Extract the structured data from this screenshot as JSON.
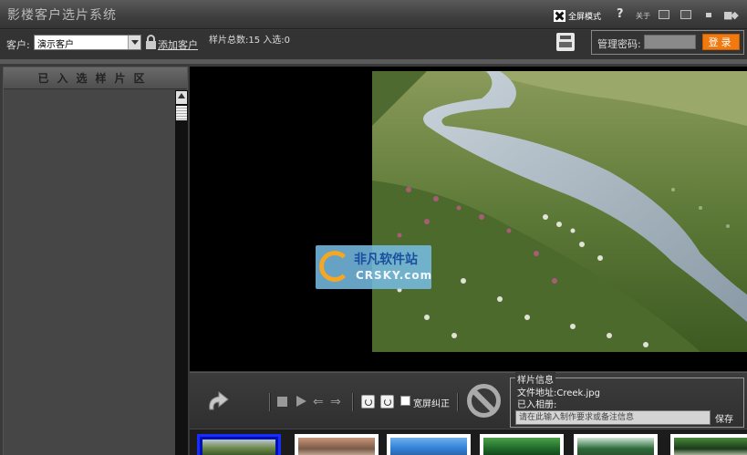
{
  "title": "影楼客户选片系统",
  "titlebar": {
    "fullscreen_label": "全屏模式",
    "help_label": "?",
    "about_label": "关于",
    "close_label": "■◆"
  },
  "toolbar": {
    "client_label": "客户:",
    "client_value": "演示客户",
    "add_client_label": "添加客户",
    "sample_stats": "样片总数:15  入选:0",
    "admin_label": "管理密码:",
    "login_label": "登录"
  },
  "left_panel": {
    "header": "已入选样片区"
  },
  "watermark": {
    "cn": "非凡软件站",
    "en": "CRSKY.com"
  },
  "controls": {
    "arrow_left": "⇐",
    "arrow_right": "⇒",
    "wide_label": "宽屏纠正"
  },
  "info": {
    "title": "样片信息",
    "file": "文件地址:Creek.jpg",
    "album": "已入相册:",
    "note_placeholder": "请在此输入制作要求或备注信息",
    "save_label": "保存"
  },
  "thumbnails": [
    {
      "name": "thumb-creek",
      "selected": true,
      "colors": [
        "#6e8a4a",
        "#b9c7d4",
        "#3d5a2a"
      ]
    },
    {
      "name": "thumb-rocks",
      "selected": false,
      "colors": [
        "#7a5a48",
        "#c9967a",
        "#d9c2b0"
      ]
    },
    {
      "name": "thumb-sky",
      "selected": false,
      "colors": [
        "#2f7fd6",
        "#6fb0ea",
        "#2a5c9a"
      ]
    },
    {
      "name": "thumb-leaf",
      "selected": false,
      "colors": [
        "#1d6a2a",
        "#4ea04a",
        "#0f3a14"
      ]
    },
    {
      "name": "thumb-falls",
      "selected": false,
      "colors": [
        "#2d6a3a",
        "#cfe6d6",
        "#2a4a2a"
      ]
    },
    {
      "name": "thumb-flower",
      "selected": false,
      "colors": [
        "#1a3a1a",
        "#4a8a3a",
        "#dfe8d0"
      ]
    }
  ]
}
